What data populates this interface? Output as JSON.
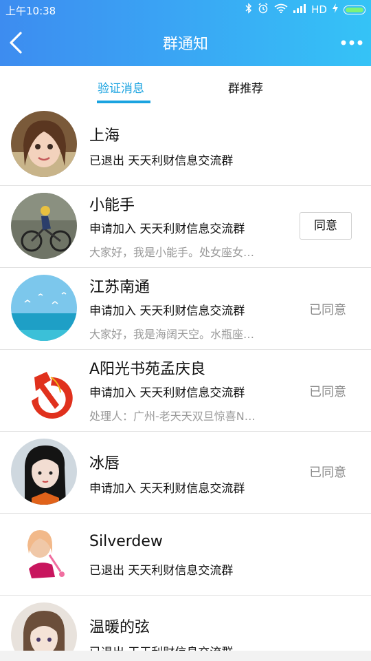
{
  "status_bar": {
    "time": "上午10:38",
    "network": "HD"
  },
  "header": {
    "title": "群通知"
  },
  "tabs": [
    {
      "label": "验证消息",
      "active": true
    },
    {
      "label": "群推荐",
      "active": false
    }
  ],
  "colors": {
    "accent": "#1aa3e0",
    "header_start": "#3d8cf0",
    "header_end": "#35c3f6",
    "secondary_text": "#9a9a9a"
  },
  "items": [
    {
      "name": "上海",
      "action": "已退出 天天利财信息交流群",
      "message": "",
      "status": ""
    },
    {
      "name": "小能手",
      "action": "申请加入 天天利财信息交流群",
      "message": "大家好，我是小能手。处女座女…",
      "button": "同意"
    },
    {
      "name": "江苏南通",
      "action": "申请加入 天天利财信息交流群",
      "message": "大家好，我是海阔天空。水瓶座…",
      "status": "已同意"
    },
    {
      "name": "A阳光书苑孟庆良",
      "action": "申请加入 天天利财信息交流群",
      "message": "处理人：广州-老天天双旦惊喜N…",
      "status": "已同意"
    },
    {
      "name": "冰唇",
      "action": "申请加入 天天利财信息交流群",
      "message": "",
      "status": "已同意"
    },
    {
      "name": "Silverdew",
      "action": "已退出 天天利财信息交流群",
      "message": "",
      "status": ""
    },
    {
      "name": "温暖的弦",
      "action": "已退出 天天利财信息交流群",
      "message": "",
      "status": ""
    }
  ]
}
